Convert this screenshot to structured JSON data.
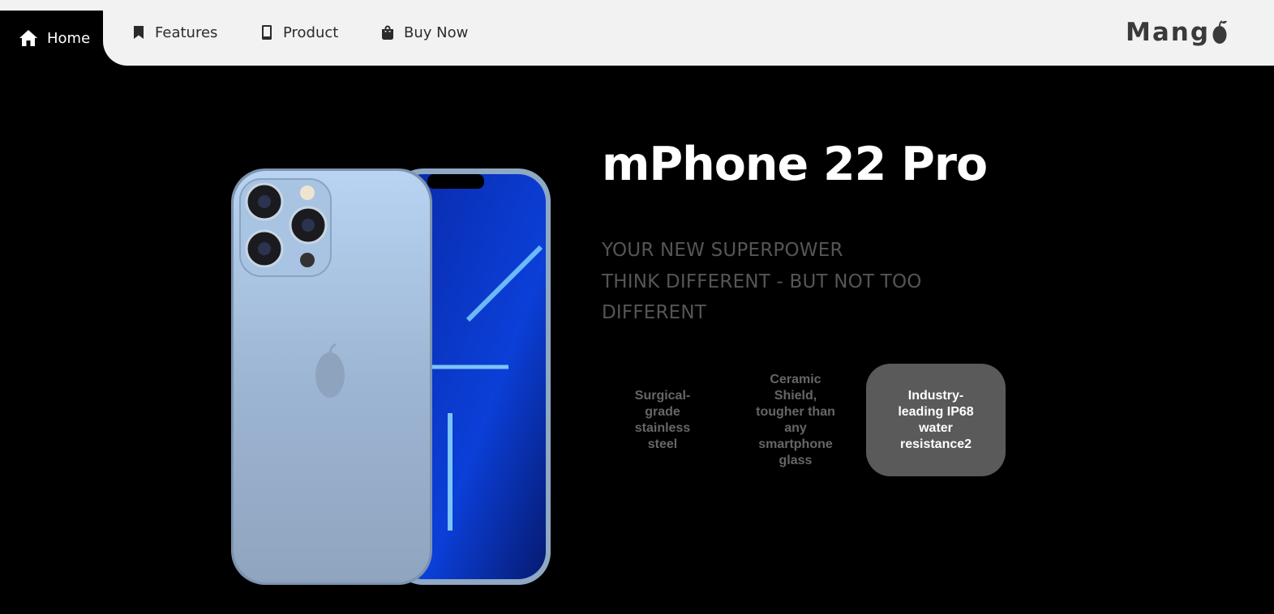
{
  "nav": {
    "items": [
      {
        "label": "Home",
        "icon": "home-icon"
      },
      {
        "label": "Features",
        "icon": "bookmark-icon"
      },
      {
        "label": "Product",
        "icon": "mobile-phone-icon"
      },
      {
        "label": "Buy Now",
        "icon": "shopping-bag-icon"
      }
    ],
    "logo_text": "Mang"
  },
  "hero": {
    "title": "mPhone 22 Pro",
    "tagline_line1": "YOUR NEW SUPERPOWER",
    "tagline_line2": "THINK DIFFERENT - BUT NOT TOO",
    "tagline_line3": "DIFFERENT"
  },
  "features": [
    {
      "text": "Surgical-grade stainless steel"
    },
    {
      "text": "Ceramic Shield, tougher than any smartphone glass"
    },
    {
      "text": "Industry-leading IP68 water resistance2"
    }
  ],
  "colors": {
    "background": "#000000",
    "nav_bg": "#f2f2f2",
    "active_card": "#5a5a5a",
    "tagline": "#555555"
  }
}
